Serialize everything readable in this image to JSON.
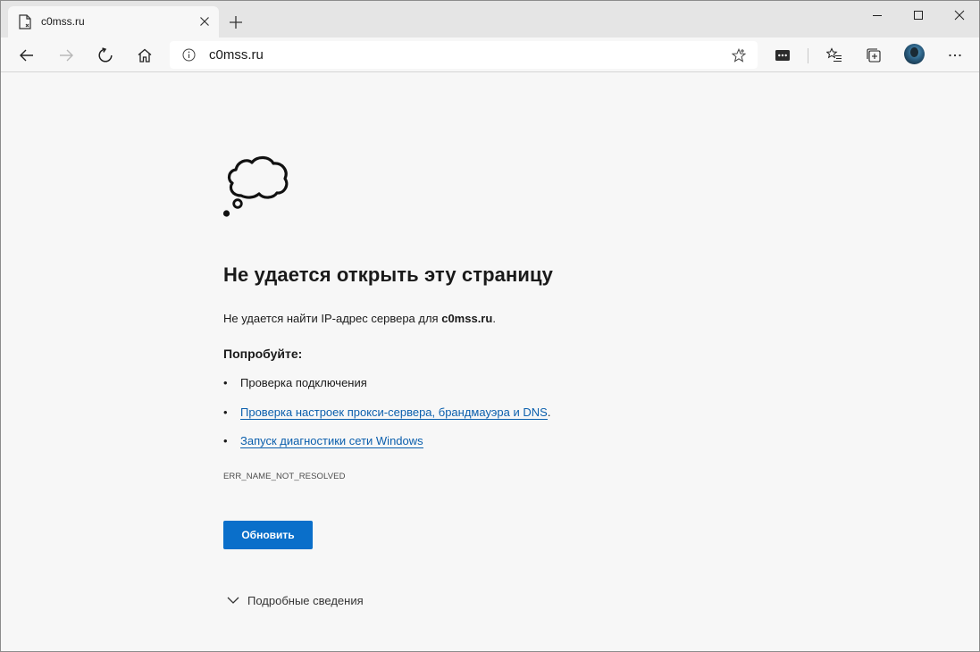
{
  "browser": {
    "tab": {
      "title": "c0mss.ru",
      "favicon": "page-broken-icon"
    },
    "address": {
      "url": "c0mss.ru"
    }
  },
  "error_page": {
    "heading": "Не удается открыть эту страницу",
    "description_prefix": "Не удается найти IP-адрес сервера для ",
    "description_host": "c0mss.ru",
    "description_suffix": ".",
    "try_label": "Попробуйте:",
    "suggestions": [
      {
        "text": "Проверка подключения",
        "is_link": false,
        "suffix": ""
      },
      {
        "text": "Проверка настроек прокси-сервера, брандмауэра и DNS",
        "is_link": true,
        "suffix": "."
      },
      {
        "text": "Запуск диагностики сети Windows",
        "is_link": true,
        "suffix": ""
      }
    ],
    "error_code": "ERR_NAME_NOT_RESOLVED",
    "refresh_label": "Обновить",
    "details_label": "Подробные сведения"
  },
  "colors": {
    "accent": "#0a6fca",
    "link": "#0b5fad",
    "titlebar": "#e5e5e5",
    "page_bg": "#f7f7f7"
  }
}
